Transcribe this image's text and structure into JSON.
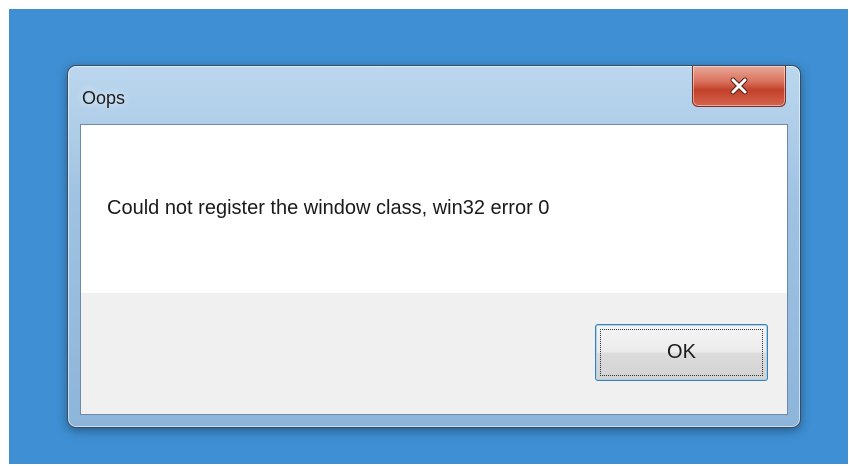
{
  "dialog": {
    "title": "Oops",
    "message": "Could not register the window class, win32 error 0",
    "ok_label": "OK",
    "close_icon": "close-icon"
  },
  "colors": {
    "desktop": "#3e8fd3",
    "close_button": "#c2402a",
    "button_area": "#f0f0f0"
  }
}
